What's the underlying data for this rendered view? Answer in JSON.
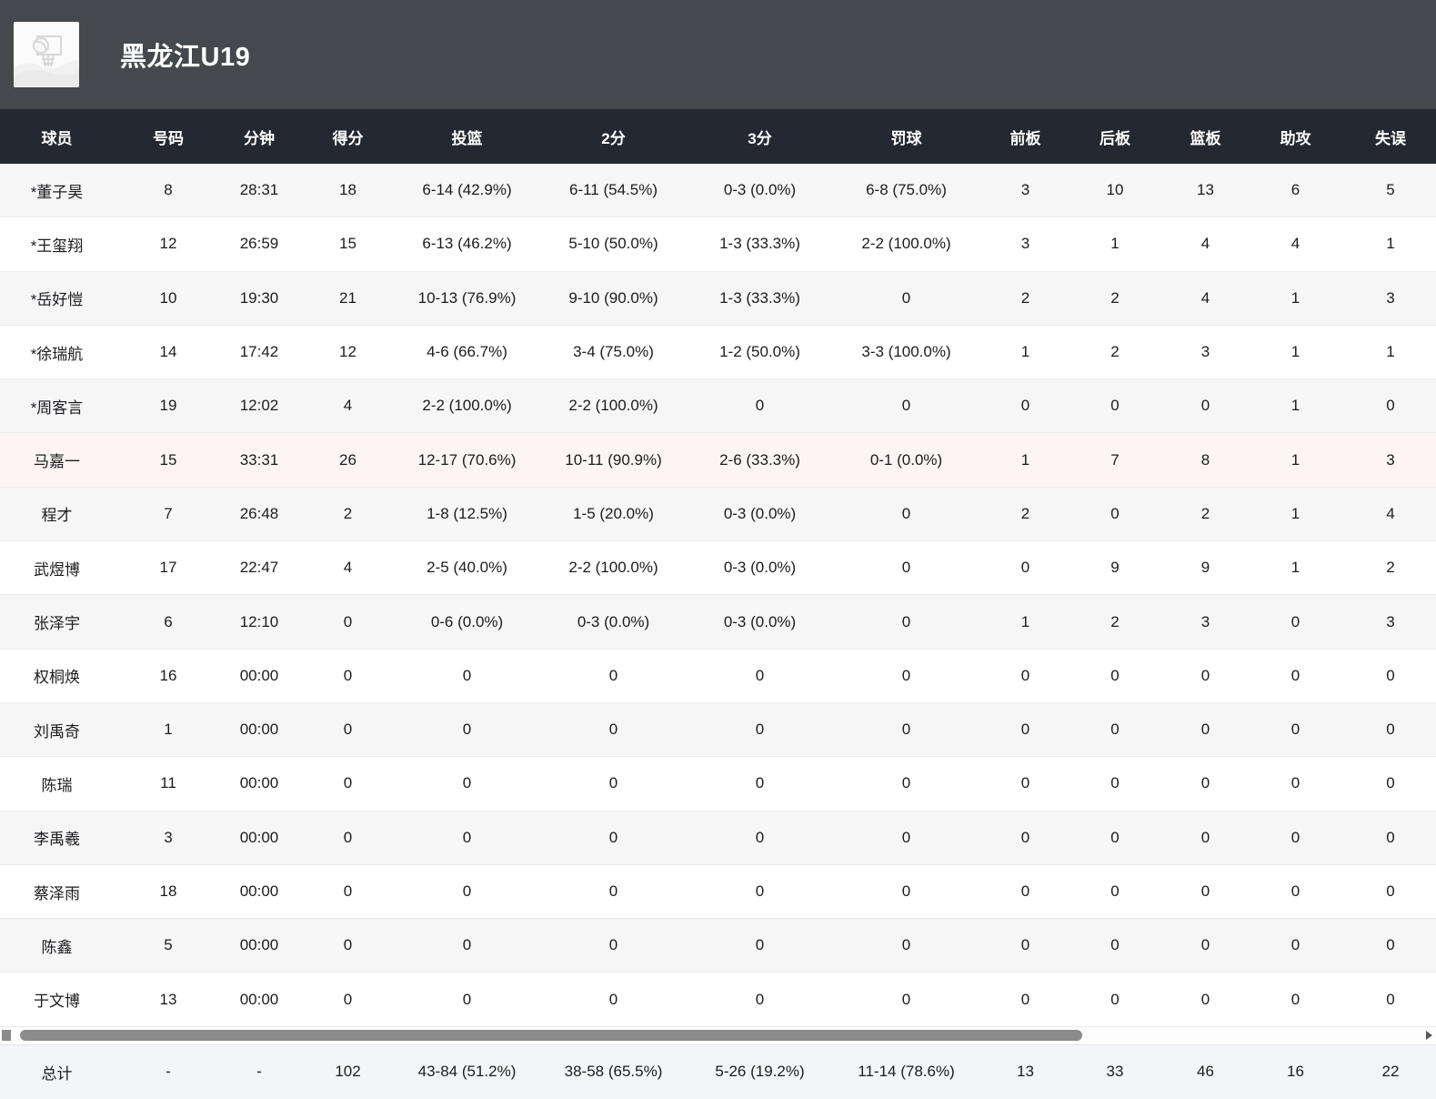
{
  "header": {
    "title": "黑龙江U19",
    "logo_icon": "basketball-hoop-placeholder-icon"
  },
  "table": {
    "columns": [
      "球员",
      "号码",
      "分钟",
      "得分",
      "投篮",
      "2分",
      "3分",
      "罚球",
      "前板",
      "后板",
      "篮板",
      "助攻",
      "失误"
    ],
    "rows": [
      {
        "name": "*董子昊",
        "number": "8",
        "minutes": "28:31",
        "points": "18",
        "fg": "6-14 (42.9%)",
        "p2": "6-11 (54.5%)",
        "p3": "0-3 (0.0%)",
        "ft": "6-8 (75.0%)",
        "oreb": "3",
        "dreb": "10",
        "reb": "13",
        "ast": "6",
        "to": "5"
      },
      {
        "name": "*王玺翔",
        "number": "12",
        "minutes": "26:59",
        "points": "15",
        "fg": "6-13 (46.2%)",
        "p2": "5-10 (50.0%)",
        "p3": "1-3 (33.3%)",
        "ft": "2-2 (100.0%)",
        "oreb": "3",
        "dreb": "1",
        "reb": "4",
        "ast": "4",
        "to": "1"
      },
      {
        "name": "*岳好愷",
        "number": "10",
        "minutes": "19:30",
        "points": "21",
        "fg": "10-13 (76.9%)",
        "p2": "9-10 (90.0%)",
        "p3": "1-3 (33.3%)",
        "ft": "0",
        "oreb": "2",
        "dreb": "2",
        "reb": "4",
        "ast": "1",
        "to": "3"
      },
      {
        "name": "*徐瑞航",
        "number": "14",
        "minutes": "17:42",
        "points": "12",
        "fg": "4-6 (66.7%)",
        "p2": "3-4 (75.0%)",
        "p3": "1-2 (50.0%)",
        "ft": "3-3 (100.0%)",
        "oreb": "1",
        "dreb": "2",
        "reb": "3",
        "ast": "1",
        "to": "1"
      },
      {
        "name": "*周客言",
        "number": "19",
        "minutes": "12:02",
        "points": "4",
        "fg": "2-2 (100.0%)",
        "p2": "2-2 (100.0%)",
        "p3": "0",
        "ft": "0",
        "oreb": "0",
        "dreb": "0",
        "reb": "0",
        "ast": "1",
        "to": "0"
      },
      {
        "name": "马嘉一",
        "number": "15",
        "minutes": "33:31",
        "points": "26",
        "fg": "12-17 (70.6%)",
        "p2": "10-11 (90.9%)",
        "p3": "2-6 (33.3%)",
        "ft": "0-1 (0.0%)",
        "oreb": "1",
        "dreb": "7",
        "reb": "8",
        "ast": "1",
        "to": "3",
        "highlight": true
      },
      {
        "name": "程才",
        "number": "7",
        "minutes": "26:48",
        "points": "2",
        "fg": "1-8 (12.5%)",
        "p2": "1-5 (20.0%)",
        "p3": "0-3 (0.0%)",
        "ft": "0",
        "oreb": "2",
        "dreb": "0",
        "reb": "2",
        "ast": "1",
        "to": "4"
      },
      {
        "name": "武煜博",
        "number": "17",
        "minutes": "22:47",
        "points": "4",
        "fg": "2-5 (40.0%)",
        "p2": "2-2 (100.0%)",
        "p3": "0-3 (0.0%)",
        "ft": "0",
        "oreb": "0",
        "dreb": "9",
        "reb": "9",
        "ast": "1",
        "to": "2"
      },
      {
        "name": "张泽宇",
        "number": "6",
        "minutes": "12:10",
        "points": "0",
        "fg": "0-6 (0.0%)",
        "p2": "0-3 (0.0%)",
        "p3": "0-3 (0.0%)",
        "ft": "0",
        "oreb": "1",
        "dreb": "2",
        "reb": "3",
        "ast": "0",
        "to": "3"
      },
      {
        "name": "权桐焕",
        "number": "16",
        "minutes": "00:00",
        "points": "0",
        "fg": "0",
        "p2": "0",
        "p3": "0",
        "ft": "0",
        "oreb": "0",
        "dreb": "0",
        "reb": "0",
        "ast": "0",
        "to": "0"
      },
      {
        "name": "刘禹奇",
        "number": "1",
        "minutes": "00:00",
        "points": "0",
        "fg": "0",
        "p2": "0",
        "p3": "0",
        "ft": "0",
        "oreb": "0",
        "dreb": "0",
        "reb": "0",
        "ast": "0",
        "to": "0"
      },
      {
        "name": "陈瑞",
        "number": "11",
        "minutes": "00:00",
        "points": "0",
        "fg": "0",
        "p2": "0",
        "p3": "0",
        "ft": "0",
        "oreb": "0",
        "dreb": "0",
        "reb": "0",
        "ast": "0",
        "to": "0"
      },
      {
        "name": "李禹羲",
        "number": "3",
        "minutes": "00:00",
        "points": "0",
        "fg": "0",
        "p2": "0",
        "p3": "0",
        "ft": "0",
        "oreb": "0",
        "dreb": "0",
        "reb": "0",
        "ast": "0",
        "to": "0"
      },
      {
        "name": "蔡泽雨",
        "number": "18",
        "minutes": "00:00",
        "points": "0",
        "fg": "0",
        "p2": "0",
        "p3": "0",
        "ft": "0",
        "oreb": "0",
        "dreb": "0",
        "reb": "0",
        "ast": "0",
        "to": "0"
      },
      {
        "name": "陈鑫",
        "number": "5",
        "minutes": "00:00",
        "points": "0",
        "fg": "0",
        "p2": "0",
        "p3": "0",
        "ft": "0",
        "oreb": "0",
        "dreb": "0",
        "reb": "0",
        "ast": "0",
        "to": "0"
      },
      {
        "name": "于文博",
        "number": "13",
        "minutes": "00:00",
        "points": "0",
        "fg": "0",
        "p2": "0",
        "p3": "0",
        "ft": "0",
        "oreb": "0",
        "dreb": "0",
        "reb": "0",
        "ast": "0",
        "to": "0"
      }
    ],
    "totals": {
      "name": "总计",
      "number": "-",
      "minutes": "-",
      "points": "102",
      "fg": "43-84 (51.2%)",
      "p2": "38-58 (65.5%)",
      "p3": "5-26 (19.2%)",
      "ft": "11-14 (78.6%)",
      "oreb": "13",
      "dreb": "33",
      "reb": "46",
      "ast": "16",
      "to": "22"
    }
  },
  "scrollbar": {
    "left_icon": "scroll-left-button-icon",
    "right_icon": "scroll-right-arrow-icon"
  },
  "colors": {
    "app_header_bg": "#45494e",
    "table_header_bg": "#242831",
    "stripe_row_bg": "#f6f6f7",
    "highlight_row_bg": "#fdf5f3",
    "totals_row_bg": "#f4f5f8",
    "scrollbar_thumb": "#8b8b8b"
  }
}
